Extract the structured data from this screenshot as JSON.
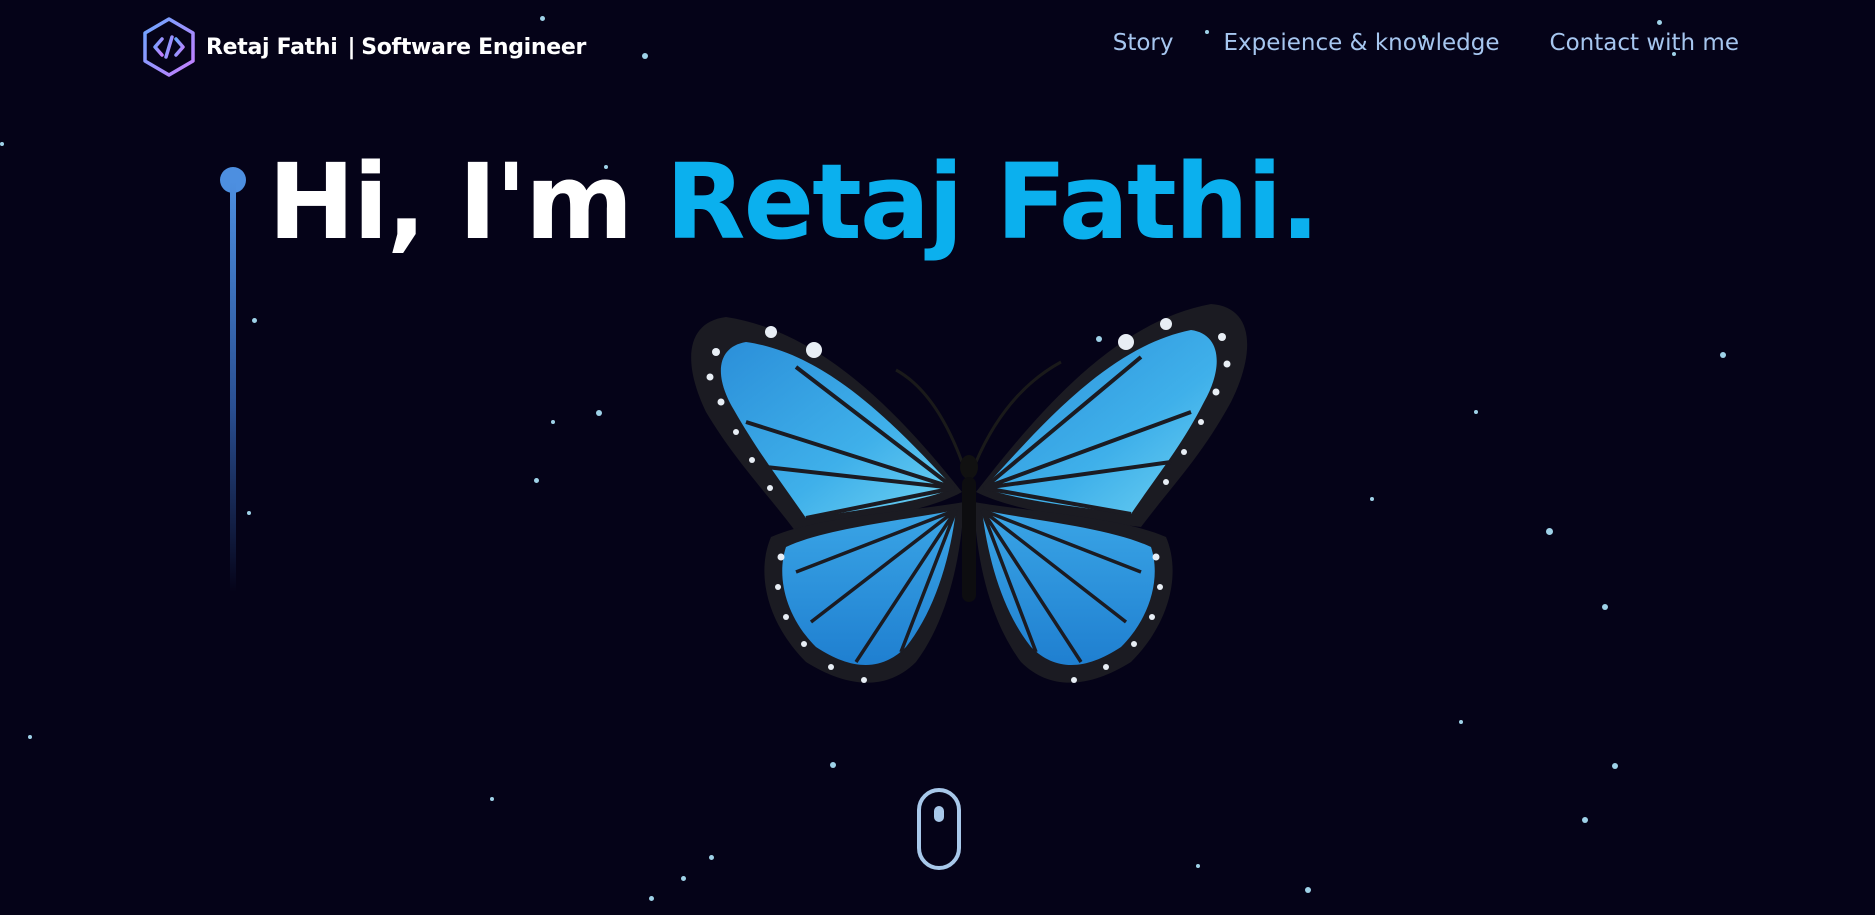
{
  "header": {
    "brand_name": "Retaj Fathi",
    "brand_separator": "|",
    "brand_role": "Software Engineer",
    "logo_icon": "code-hexagon-icon"
  },
  "nav": {
    "items": [
      {
        "label": "Story"
      },
      {
        "label": "Expeience & knowledge"
      },
      {
        "label": "Contact with me"
      }
    ]
  },
  "hero": {
    "greeting": "Hi, I'm",
    "name": "Retaj Fathi.",
    "image": "blue-butterfly",
    "scroll_icon": "mouse-scroll-icon"
  },
  "colors": {
    "background": "#050318",
    "accent": "#0bb0ee",
    "nav_text": "#a6c6ef",
    "line": "#4d8fe0"
  }
}
